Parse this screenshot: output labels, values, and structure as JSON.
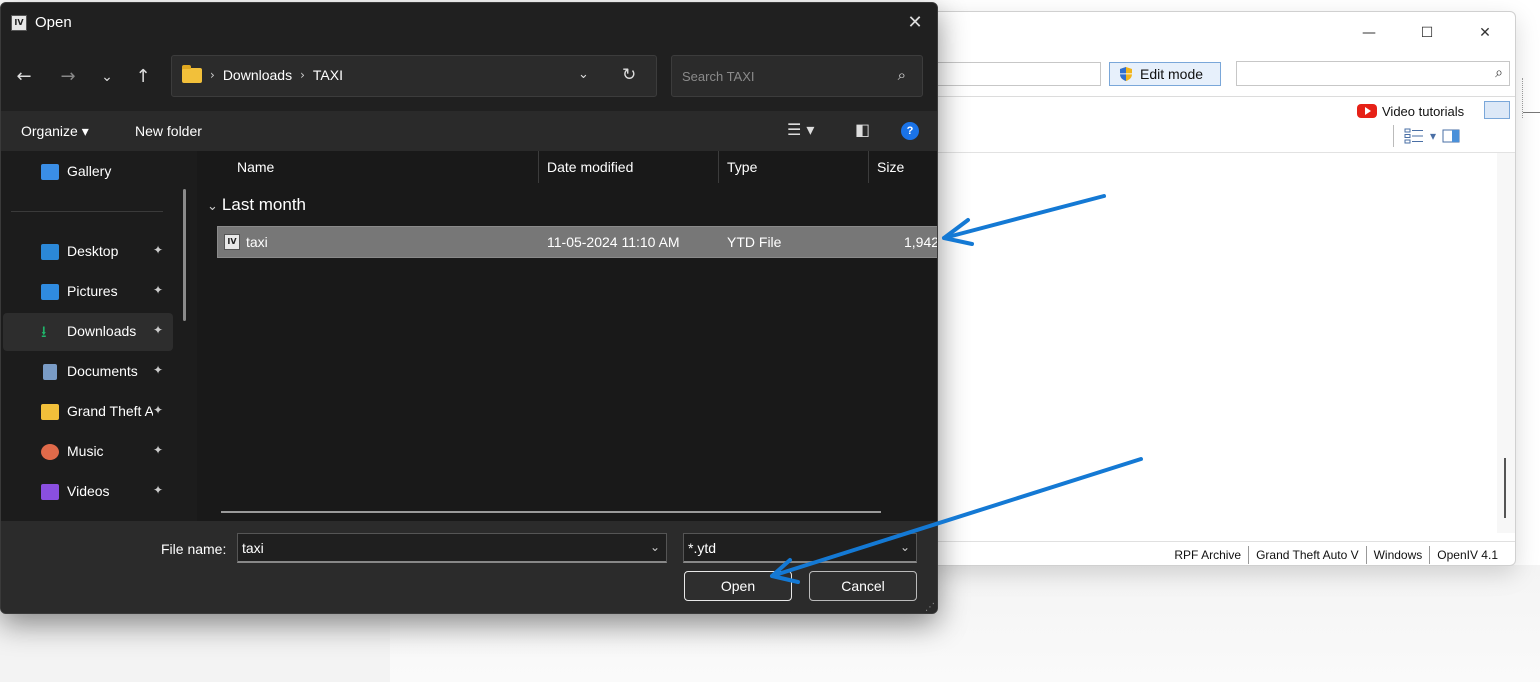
{
  "background_window": {
    "minimize_glyph": "—",
    "maximize_glyph": "☐",
    "close_glyph": "✕",
    "edit_mode_label": "Edit mode",
    "video_tutorials_label": "Video tutorials",
    "status": [
      "RPF Archive",
      "Grand Theft Auto V",
      "Windows",
      "OpenIV 4.1"
    ]
  },
  "dialog": {
    "title": "Open",
    "app_icon_text": "IV",
    "close_glyph": "✕",
    "nav": {
      "back": "←",
      "forward": "→",
      "recent": "⌄",
      "up": "↑"
    },
    "breadcrumb": [
      "Downloads",
      "TAXI"
    ],
    "breadcrumb_sep": "›",
    "search_placeholder": "Search TAXI",
    "commands": {
      "organize": "Organize ▾",
      "new_folder": "New folder"
    },
    "sidebar": [
      {
        "label": "Gallery",
        "icon": "gallery-icon",
        "color": "#3a8ee6",
        "pinned": false
      },
      {
        "label": "Desktop",
        "icon": "desktop-icon",
        "color": "#2b88d8",
        "pinned": true
      },
      {
        "label": "Pictures",
        "icon": "pictures-icon",
        "color": "#2f8be0",
        "pinned": true
      },
      {
        "label": "Downloads",
        "icon": "download-icon",
        "color": "#1fb56a",
        "pinned": true
      },
      {
        "label": "Documents",
        "icon": "documents-icon",
        "color": "#7a9cc6",
        "pinned": true
      },
      {
        "label": "Grand Theft Auto V",
        "icon": "folder-icon",
        "color": "#f2c03a",
        "pinned": true
      },
      {
        "label": "Music",
        "icon": "music-icon",
        "color": "#e06a4a",
        "pinned": true
      },
      {
        "label": "Videos",
        "icon": "videos-icon",
        "color": "#8a4fe0",
        "pinned": true
      }
    ],
    "pin_glyph": "📌",
    "columns": [
      "Name",
      "Date modified",
      "Type",
      "Size"
    ],
    "group": "Last month",
    "files": [
      {
        "name": "taxi",
        "date": "11-05-2024 11:10 AM",
        "type": "YTD File",
        "size": "1,942"
      }
    ],
    "file_name_label": "File name:",
    "file_name_value": "taxi",
    "filter_value": "*.ytd",
    "open_label": "Open",
    "cancel_label": "Cancel"
  },
  "annotation_color": "#1479d4"
}
